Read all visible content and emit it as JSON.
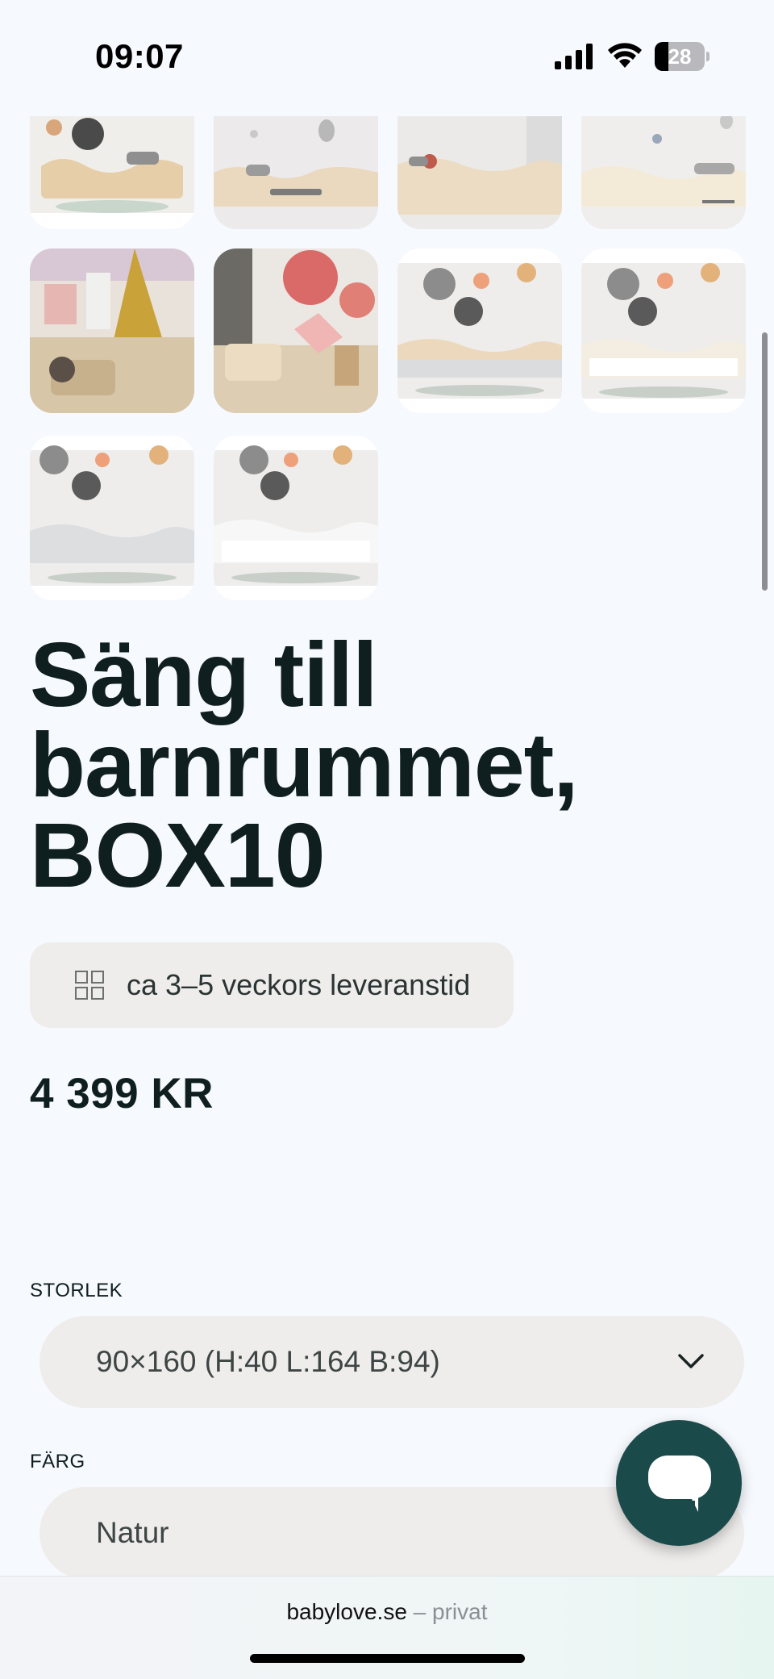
{
  "status_bar": {
    "time": "09:07",
    "battery_level": "28",
    "battery_percent": 28,
    "icons": [
      "cellular-signal-icon",
      "wifi-icon",
      "battery-icon"
    ]
  },
  "gallery": {
    "thumbnails": [
      {
        "alt": "bed-natural-wave-headboard"
      },
      {
        "alt": "bed-natural-clouds-balloon"
      },
      {
        "alt": "bed-natural-wave"
      },
      {
        "alt": "bed-white-wave-balloons"
      },
      {
        "alt": "kids-room-canopy"
      },
      {
        "alt": "kids-room-red-circles"
      },
      {
        "alt": "bed-grey-wave-rosettes"
      },
      {
        "alt": "bed-white-wave-rosettes"
      },
      {
        "alt": "bed-light-grey-rosettes"
      },
      {
        "alt": "bed-white-rosettes"
      }
    ]
  },
  "product": {
    "title_lines": [
      "Säng till",
      "barnrummet,",
      "BOX10"
    ],
    "delivery_text": "ca 3–5 veckors leveranstid",
    "price": "4 399 KR"
  },
  "options": {
    "size_label": "STORLEK",
    "size_value": "90×160 (H:40 L:164 B:94)",
    "color_label": "FÄRG",
    "color_value": "Natur"
  },
  "browser": {
    "domain": "babylove.se",
    "suffix": " – privat"
  },
  "colors": {
    "background": "#f6f9fd",
    "text": "#0f1e1e",
    "pill": "#efedeb",
    "chat_button": "#1b4a4a"
  }
}
